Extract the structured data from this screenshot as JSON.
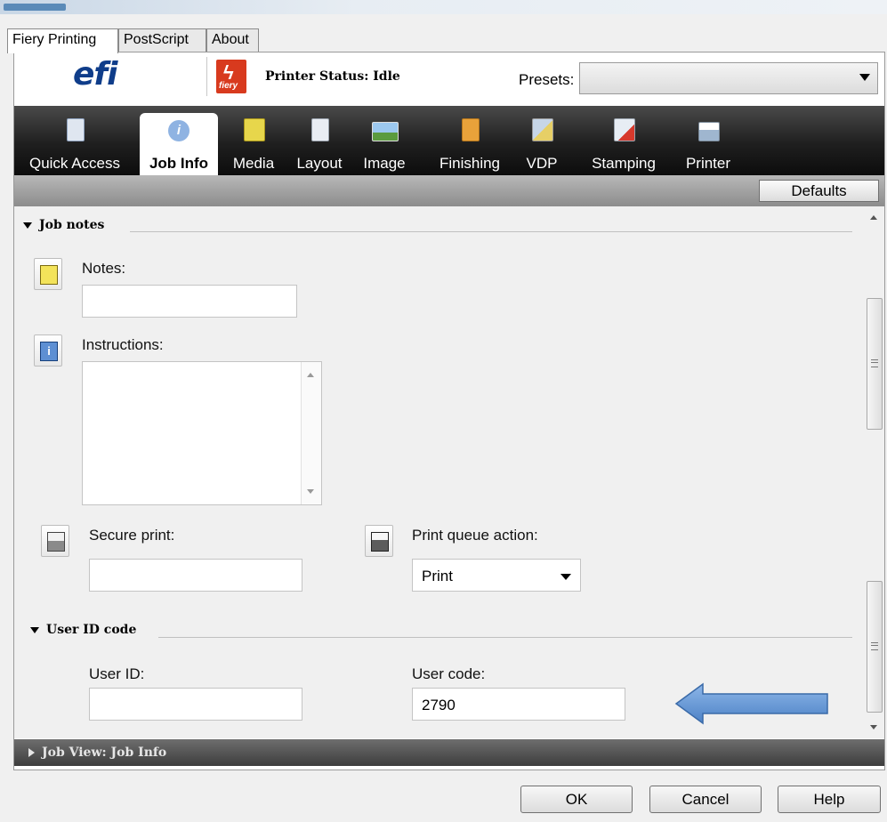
{
  "outer_tabs": [
    "Fiery Printing",
    "PostScript",
    "About"
  ],
  "header": {
    "logo_text": "efi",
    "fiery_badge": "fiery",
    "printer_status": "Printer Status: Idle",
    "presets_label": "Presets:",
    "presets_value": ""
  },
  "toolbar": {
    "items": [
      {
        "label": "Quick Access",
        "icon": "quick-access-icon"
      },
      {
        "label": "Job Info",
        "icon": "info-icon",
        "active": true
      },
      {
        "label": "Media",
        "icon": "media-icon"
      },
      {
        "label": "Layout",
        "icon": "layout-icon"
      },
      {
        "label": "Image",
        "icon": "image-icon"
      },
      {
        "label": "Finishing",
        "icon": "finishing-icon"
      },
      {
        "label": "VDP",
        "icon": "vdp-icon"
      },
      {
        "label": "Stamping",
        "icon": "stamping-icon"
      },
      {
        "label": "Printer",
        "icon": "printer-icon"
      }
    ],
    "defaults_label": "Defaults"
  },
  "job_notes": {
    "section_title": "Job notes",
    "notes_label": "Notes:",
    "notes_value": "",
    "instructions_label": "Instructions:",
    "instructions_value": "",
    "secure_print_label": "Secure print:",
    "secure_print_value": "",
    "print_queue_label": "Print queue action:",
    "print_queue_value": "Print"
  },
  "user_id_code": {
    "section_title": "User ID code",
    "user_id_label": "User ID:",
    "user_id_value": "",
    "user_code_label": "User code:",
    "user_code_value": "2790"
  },
  "job_view": "Job View: Job Info",
  "buttons": {
    "ok": "OK",
    "cancel": "Cancel",
    "help": "Help"
  },
  "colors": {
    "efi_blue": "#0f3d8a",
    "fiery_red": "#d83a1e",
    "arrow_blue": "#6f9fd8"
  }
}
